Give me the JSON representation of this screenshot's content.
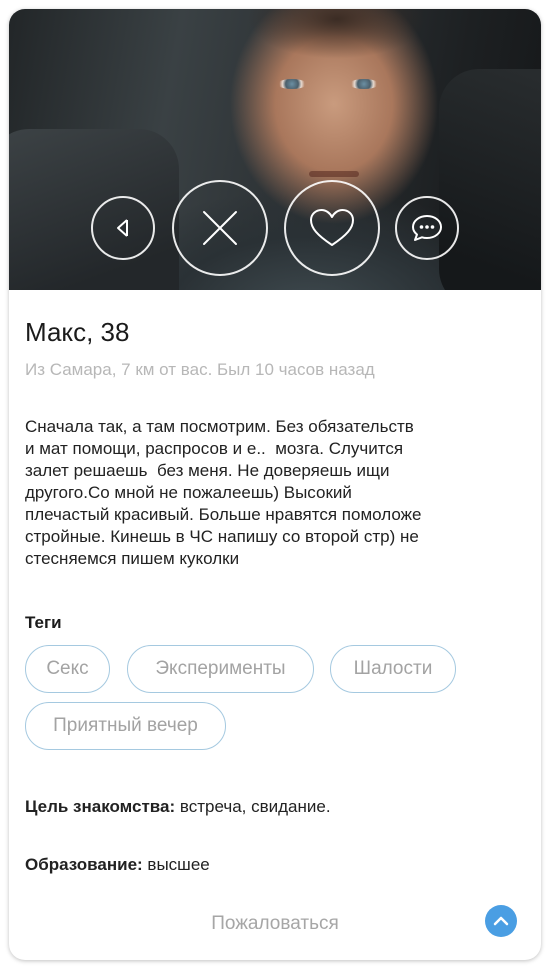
{
  "profile": {
    "name_age": "Макс, 38",
    "meta": "Из Самара, 7 км от вас. Был 10 часов назад",
    "about": "Сначала так, а там посмотрим. Без обязательств\nи мат помощи, распросов и е..  мозга. Случится\nзалет решаешь  без меня. Не доверяешь ищи\nдругого.Со мной не пожалеешь) Высокий\nплечастый красивый. Больше нравятся помоложе\nстройные. Кинешь в ЧС напишу со второй стр) не\nстесняемся пишем куколки"
  },
  "actions": {
    "back_icon": "back-triangle-icon",
    "skip_icon": "close-icon",
    "like_icon": "heart-icon",
    "message_icon": "chat-bubble-icon"
  },
  "tags": {
    "title": "Теги",
    "items": [
      {
        "label": "Секс"
      },
      {
        "label": "Эксперименты"
      },
      {
        "label": "Шалости"
      },
      {
        "label": "Приятный вечер"
      }
    ]
  },
  "details": {
    "goal_label": "Цель знакомства:",
    "goal_value": " встреча, свидание.",
    "education_label": "Образование:",
    "education_value": " высшее"
  },
  "footer": {
    "report_label": "Пожаловаться",
    "scroll_up_icon": "chevron-up-icon"
  },
  "colors": {
    "tag_border": "#a5c9e0",
    "accent": "#4a9ee3",
    "muted_text": "#b7b7b7"
  }
}
